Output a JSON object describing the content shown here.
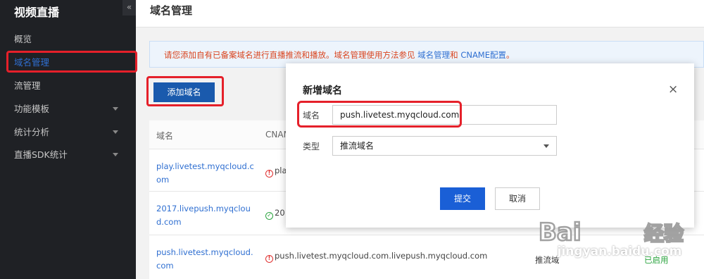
{
  "sidebar": {
    "title": "视频直播",
    "collapse_label": "«",
    "items": [
      {
        "label": "概览"
      },
      {
        "label": "域名管理"
      },
      {
        "label": "流管理"
      },
      {
        "label": "功能模板"
      },
      {
        "label": "统计分析"
      },
      {
        "label": "直播SDK统计"
      }
    ]
  },
  "header": {
    "title": "域名管理"
  },
  "notice": {
    "text": "请您添加自有已备案域名进行直播推流和播放。域名管理使用方法参见",
    "link1": "域名管理",
    "sep": "和",
    "link2": "CNAME配置",
    "end": "。"
  },
  "toolbar": {
    "add_label": "添加域名"
  },
  "table": {
    "columns": [
      "域名",
      "CNAME"
    ],
    "rows": [
      {
        "domain": "play.livetest.myqcloud.com",
        "cname": "pla",
        "status_icon": "error-icon"
      },
      {
        "domain": "2017.livepush.myqcloud.com",
        "cname": "20",
        "status_icon": "success-icon"
      },
      {
        "domain": "push.livetest.myqcloud.com",
        "cname": "push.livetest.myqcloud.com.livepush.myqcloud.com",
        "status_icon": "error-icon",
        "type": "推流域",
        "status": "已启用"
      }
    ]
  },
  "modal": {
    "title": "新增域名",
    "close_label": "×",
    "domain_label": "域名",
    "domain_value": "push.livetest.myqcloud.com",
    "type_label": "类型",
    "type_value": "推流域名",
    "submit_label": "提交",
    "cancel_label": "取消"
  },
  "watermark": {
    "text": "jingyan.baidu.com"
  },
  "colors": {
    "accent": "#1a5fd6",
    "highlight": "#e5202a",
    "error": "#e0302f",
    "success": "#2aa33e"
  }
}
